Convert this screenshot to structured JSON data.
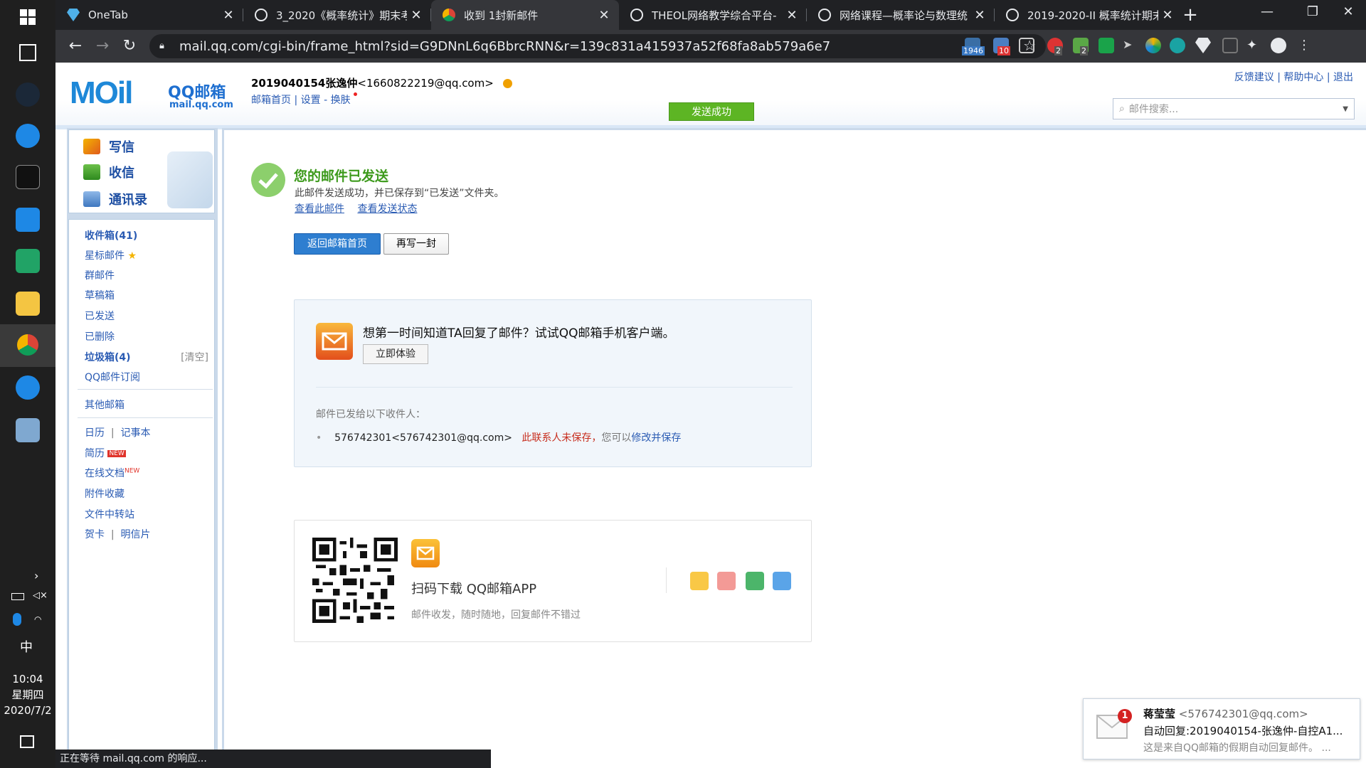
{
  "browser": {
    "tabs": [
      {
        "label": "OneTab",
        "active": false
      },
      {
        "label": "3_2020《概率统计》期末考",
        "active": false
      },
      {
        "label": "收到 1封新邮件",
        "active": true
      },
      {
        "label": "THEOL网络教学综合平台-",
        "active": false
      },
      {
        "label": "网络课程—概率论与数理统",
        "active": false
      },
      {
        "label": "2019-2020-II 概率统计期末",
        "active": false
      }
    ],
    "url": "mail.qq.com/cgi-bin/frame_html?sid=G9DNnL6q6BbrcRNN&r=139c831a415937a52f68fa8ab579a6e7",
    "ext_badges": [
      "1946",
      "10",
      "2",
      "2"
    ],
    "status": "正在等待 mail.qq.com 的响应..."
  },
  "header": {
    "logo_text": "MOil",
    "logo_qq": "QQ邮箱",
    "logo_domain": "mail.qq.com",
    "user": "2019040154张逸仲",
    "email": "<1660822219@qq.com>",
    "links": [
      "邮箱首页",
      "设置",
      "换肤"
    ],
    "toplinks": [
      "反馈建议",
      "帮助中心",
      "退出"
    ],
    "send_ok": "发送成功",
    "search_placeholder": "邮件搜索..."
  },
  "sidebar": {
    "actions": [
      "写信",
      "收信",
      "通讯录"
    ],
    "inbox": "收件箱(41)",
    "star": "星标邮件",
    "group": "群邮件",
    "draft": "草稿箱",
    "sent": "已发送",
    "deleted": "已删除",
    "spam": "垃圾箱(4)",
    "clear": "[清空]",
    "subscribe": "QQ邮件订阅",
    "other": "其他邮箱",
    "calendar": "日历",
    "notes": "记事本",
    "resume": "简历",
    "new1": "NEW",
    "docs": "在线文档",
    "new2": "NEW",
    "attach": "附件收藏",
    "transfer": "文件中转站",
    "card": "贺卡",
    "postcard": "明信片"
  },
  "main": {
    "title": "您的邮件已发送",
    "desc": "此邮件发送成功，并已保存到“已发送”文件夹。",
    "link_view": "查看此邮件",
    "link_status": "查看发送状态",
    "btn_home": "返回邮箱首页",
    "btn_again": "再写一封",
    "promo_title": "想第一时间知道TA回复了邮件？试试QQ邮箱手机客户端。",
    "promo_try": "立即体验",
    "sent_to": "邮件已发给以下收件人：",
    "recipient": "576742301<576742301@qq.com>",
    "not_saved": "此联系人未保存，",
    "hint": "您可以",
    "modify": "修改并保存",
    "app_title": "扫码下载 QQ邮箱APP",
    "app_sub": "邮件收发，随时随地，回复邮件不错过"
  },
  "notification": {
    "count": "1",
    "from": "蒋莹莹",
    "from_addr": "<576742301@qq.com>",
    "subject": "自动回复:2019040154-张逸仲-自控A1...",
    "preview": "这是来自QQ邮箱的假期自动回复邮件。 ..."
  },
  "system": {
    "time": "10:04",
    "weekday": "星期四",
    "date": "2020/7/2",
    "ime": "中"
  }
}
